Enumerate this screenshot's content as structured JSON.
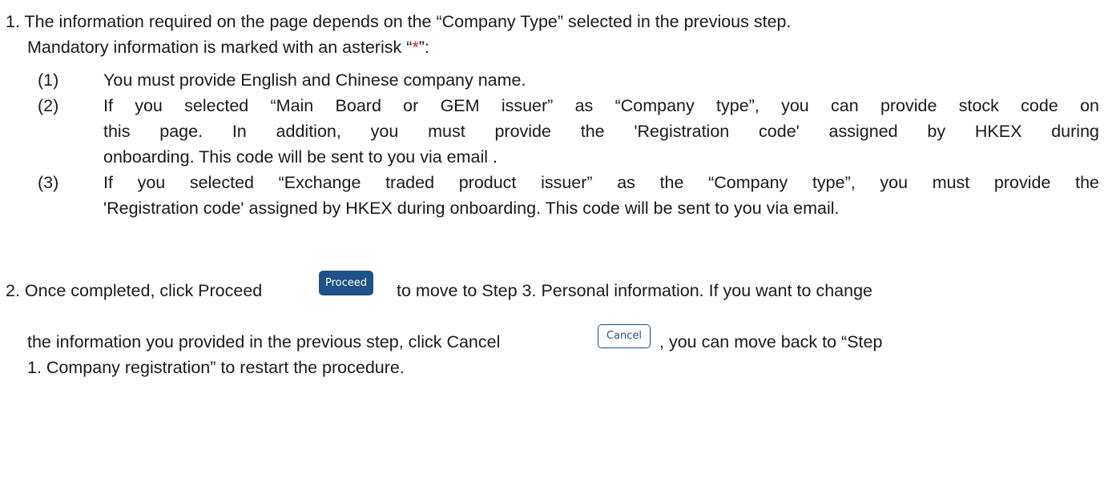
{
  "item1": {
    "line1": "1. The information required on the page depends on the “Company Type” selected in the previous step.",
    "line2_prefix": "Mandatory information is marked with an asterisk “",
    "asterisk": "*",
    "line2_suffix": "”:",
    "subitems": [
      {
        "num": "(1)",
        "lines": [
          "You must provide English and Chinese company name."
        ]
      },
      {
        "num": "(2)",
        "lines": [
          "If you selected “Main Board or GEM issuer” as “Company type”, you can provide stock code on",
          "this page. In addition, you must provide the 'Registration code' assigned by HKEX during",
          "onboarding. This code will be sent to you via email ."
        ]
      },
      {
        "num": "(3)",
        "lines": [
          "If you selected “Exchange traded product issuer” as the “Company type”, you must provide the",
          "'Registration code' assigned by HKEX during onboarding. This code will be sent to you via email."
        ]
      }
    ]
  },
  "item2": {
    "line1_prefix": "2. Once completed, click Proceed",
    "proceed_label": "Proceed",
    "line1_suffix": "to move to Step 3. Personal information. If you want to change",
    "line2_prefix": "the information you provided in the previous step, click Cancel",
    "cancel_label": "Cancel",
    "line2_suffix": ", you can move back to “Step",
    "line3": "1. Company registration” to restart the procedure."
  },
  "colors": {
    "asterisk": "#e5231a",
    "button_primary": "#1f5288"
  }
}
